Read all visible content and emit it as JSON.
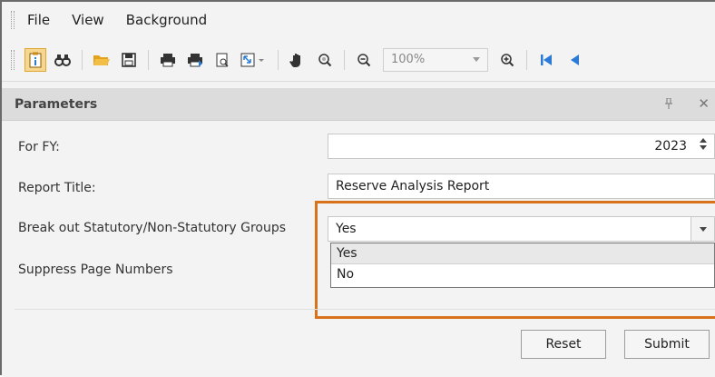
{
  "menu": [
    "File",
    "View",
    "Background"
  ],
  "toolbar": {
    "zoom_value": "100%",
    "icons": [
      "parameters-icon",
      "find-icon",
      "open-icon",
      "save-icon",
      "print-icon",
      "quick-print-icon",
      "page-setup-icon",
      "scale-icon",
      "hand-tool-icon",
      "magnifier-icon",
      "zoom-out-icon",
      "zoom-in-icon",
      "first-page-icon",
      "previous-page-icon"
    ]
  },
  "panel": {
    "title": "Parameters"
  },
  "params": {
    "fy_label": "For FY:",
    "fy_value": "2023",
    "title_label": "Report Title:",
    "title_value": "Reserve Analysis Report",
    "breakout_label": "Break out Statutory/Non-Statutory Groups",
    "breakout_value": "Yes",
    "breakout_options": [
      "Yes",
      "No"
    ],
    "suppress_label": "Suppress Page Numbers"
  },
  "buttons": {
    "reset": "Reset",
    "submit": "Submit"
  },
  "colors": {
    "highlight": "#d8731c",
    "active_tool": "#f7d78f",
    "accent_blue": "#2b7bd6"
  }
}
